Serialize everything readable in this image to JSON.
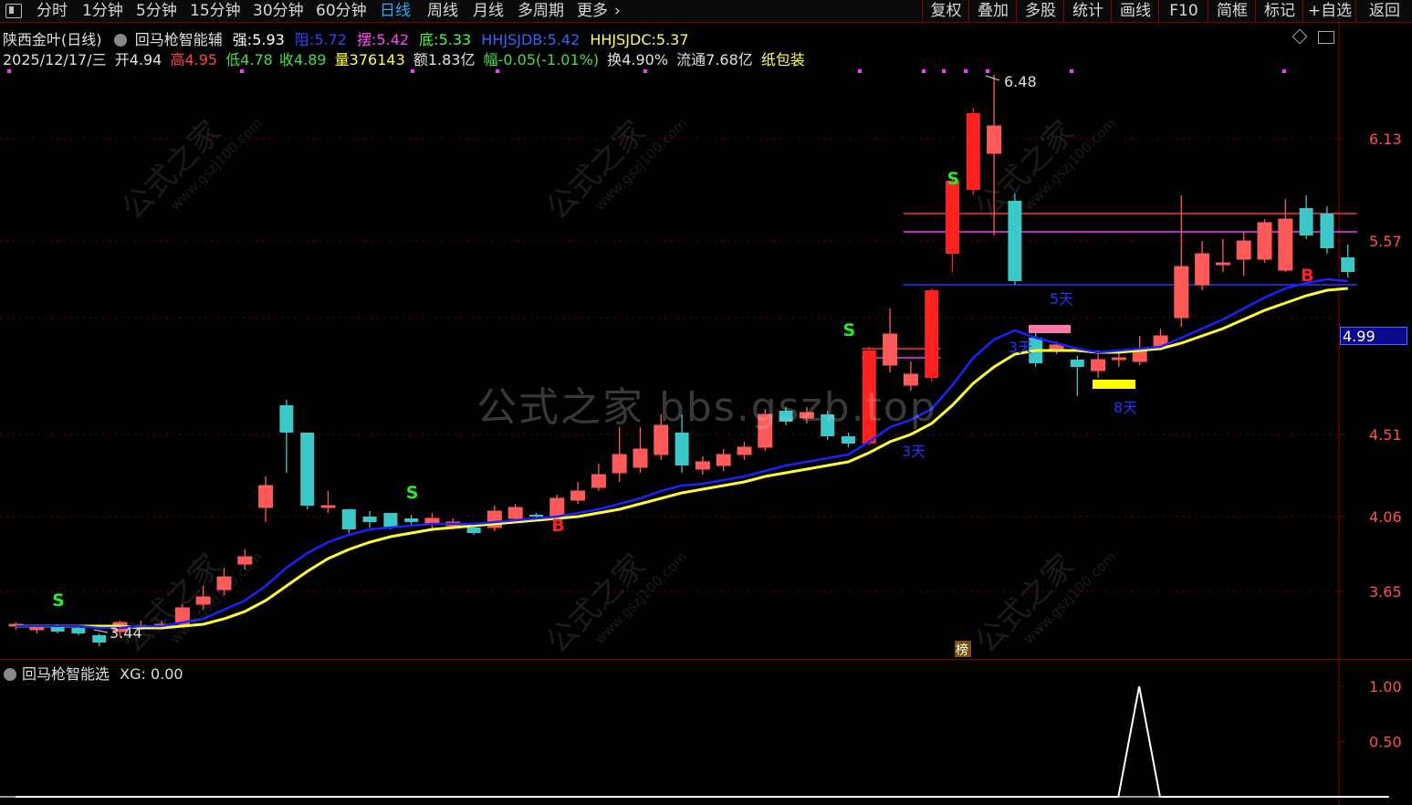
{
  "toolbar": {
    "periods": [
      "分时",
      "1分钟",
      "5分钟",
      "15分钟",
      "30分钟",
      "60分钟",
      "日线",
      "周线",
      "月线",
      "多周期",
      "更多"
    ],
    "active_period": "日线",
    "more_chevron": "›",
    "right_buttons": [
      "复权",
      "叠加",
      "多股",
      "统计",
      "画线",
      "F10",
      "简框",
      "标记",
      "+自选",
      "返回"
    ]
  },
  "header": {
    "stock_name": "陕西金叶(日线)",
    "indicator_name": "回马枪智能辅",
    "strong_label": "强:",
    "strong_value": "5.93",
    "resist_label": "阻:",
    "resist_value": "5.72",
    "swing_label": "摆:",
    "swing_value": "5.42",
    "bottom_label": "底:",
    "bottom_value": "5.33",
    "hhjsjdb_label": "HHJSJDB:",
    "hhjsjdb_value": "5.42",
    "hhjsjdc_label": "HHJSJDC:",
    "hhjsjdc_value": "5.37"
  },
  "quote": {
    "date": "2025/12/17/三",
    "open_label": "开",
    "open": "4.94",
    "high_label": "高",
    "high": "4.95",
    "low_label": "低",
    "low": "4.78",
    "close_label": "收",
    "close": "4.89",
    "volume_label": "量",
    "volume": "376143",
    "amount_label": "额",
    "amount": "1.83亿",
    "change_label": "幅",
    "change": "-0.05(-1.01%)",
    "turnover_label": "换",
    "turnover": "4.90%",
    "float_label": "流通",
    "float": "7.68亿",
    "sector": "纸包装"
  },
  "price_axis": [
    "6.13",
    "5.57",
    "4.51",
    "4.06",
    "3.65"
  ],
  "current_price_tag": "4.99",
  "annotations": {
    "high_marker": "6.48",
    "low_marker": "3.44",
    "signal_S": "S",
    "signal_B": "B",
    "days_5": "5天",
    "days_3": "3天",
    "days_8": "8天",
    "days_3b": "3天",
    "badge": "榜"
  },
  "indicator": {
    "name": "回马枪智能选",
    "xg_label": "XG:",
    "xg_value": "0.00",
    "axis": [
      "1.00",
      "0.50"
    ]
  },
  "watermarks": {
    "center": "公式之家 bbs.gszb.top",
    "diag_cn": "公式之家",
    "diag_url": "www.gszj100.com"
  },
  "colors": {
    "up": "#ff5a5a",
    "up_solid": "#ff2020",
    "down": "#3cc8c8",
    "ma_fast": "#1a22ff",
    "ma_slow": "#ffff33",
    "grid": "#7a0000",
    "axis_text": "#ff5050"
  },
  "chart_data": {
    "type": "candlestick",
    "ylim": [
      3.4,
      6.5
    ],
    "candles": [
      {
        "o": 3.46,
        "c": 3.47,
        "h": 3.48,
        "l": 3.44
      },
      {
        "o": 3.44,
        "c": 3.46,
        "h": 3.47,
        "l": 3.42
      },
      {
        "o": 3.46,
        "c": 3.43,
        "h": 3.47,
        "l": 3.42
      },
      {
        "o": 3.45,
        "c": 3.42,
        "h": 3.46,
        "l": 3.41
      },
      {
        "o": 3.41,
        "c": 3.37,
        "h": 3.42,
        "l": 3.35
      },
      {
        "o": 3.43,
        "c": 3.48,
        "h": 3.49,
        "l": 3.4
      },
      {
        "o": 3.46,
        "c": 3.46,
        "h": 3.49,
        "l": 3.44
      },
      {
        "o": 3.45,
        "c": 3.47,
        "h": 3.49,
        "l": 3.44
      },
      {
        "o": 3.47,
        "c": 3.56,
        "h": 3.58,
        "l": 3.46
      },
      {
        "o": 3.58,
        "c": 3.62,
        "h": 3.68,
        "l": 3.55
      },
      {
        "o": 3.66,
        "c": 3.73,
        "h": 3.78,
        "l": 3.63
      },
      {
        "o": 3.8,
        "c": 3.84,
        "h": 3.88,
        "l": 3.77
      },
      {
        "o": 4.11,
        "c": 4.23,
        "h": 4.28,
        "l": 4.03
      },
      {
        "o": 4.67,
        "c": 4.52,
        "h": 4.7,
        "l": 4.3
      },
      {
        "o": 4.52,
        "c": 4.12,
        "h": 4.52,
        "l": 4.1
      },
      {
        "o": 4.12,
        "c": 4.12,
        "h": 4.2,
        "l": 4.08
      },
      {
        "o": 4.1,
        "c": 3.99,
        "h": 4.1,
        "l": 3.97
      },
      {
        "o": 4.06,
        "c": 4.03,
        "h": 4.09,
        "l": 4.0
      },
      {
        "o": 4.08,
        "c": 4.0,
        "h": 4.08,
        "l": 3.99
      },
      {
        "o": 4.05,
        "c": 4.03,
        "h": 4.07,
        "l": 4.01
      },
      {
        "o": 4.02,
        "c": 4.05,
        "h": 4.08,
        "l": 3.98
      },
      {
        "o": 4.01,
        "c": 4.03,
        "h": 4.05,
        "l": 3.99
      },
      {
        "o": 4.0,
        "c": 3.97,
        "h": 4.02,
        "l": 3.96
      },
      {
        "o": 4.0,
        "c": 4.09,
        "h": 4.12,
        "l": 3.98
      },
      {
        "o": 4.05,
        "c": 4.11,
        "h": 4.13,
        "l": 4.03
      },
      {
        "o": 4.07,
        "c": 4.06,
        "h": 4.08,
        "l": 4.05
      },
      {
        "o": 4.05,
        "c": 4.16,
        "h": 4.18,
        "l": 4.04
      },
      {
        "o": 4.15,
        "c": 4.2,
        "h": 4.25,
        "l": 4.13
      },
      {
        "o": 4.22,
        "c": 4.29,
        "h": 4.35,
        "l": 4.2
      },
      {
        "o": 4.3,
        "c": 4.4,
        "h": 4.55,
        "l": 4.25
      },
      {
        "o": 4.33,
        "c": 4.43,
        "h": 4.55,
        "l": 4.3
      },
      {
        "o": 4.4,
        "c": 4.56,
        "h": 4.62,
        "l": 4.37
      },
      {
        "o": 4.52,
        "c": 4.34,
        "h": 4.62,
        "l": 4.3
      },
      {
        "o": 4.32,
        "c": 4.36,
        "h": 4.39,
        "l": 4.29
      },
      {
        "o": 4.34,
        "c": 4.4,
        "h": 4.43,
        "l": 4.31
      },
      {
        "o": 4.4,
        "c": 4.44,
        "h": 4.47,
        "l": 4.37
      },
      {
        "o": 4.44,
        "c": 4.62,
        "h": 4.65,
        "l": 4.42
      },
      {
        "o": 4.64,
        "c": 4.58,
        "h": 4.66,
        "l": 4.56
      },
      {
        "o": 4.6,
        "c": 4.63,
        "h": 4.66,
        "l": 4.57
      },
      {
        "o": 4.62,
        "c": 4.5,
        "h": 4.64,
        "l": 4.48
      },
      {
        "o": 4.5,
        "c": 4.46,
        "h": 4.52,
        "l": 4.44
      },
      {
        "o": 4.46,
        "c": 4.97,
        "h": 4.99,
        "l": 4.45
      },
      {
        "o": 4.89,
        "c": 5.06,
        "h": 5.2,
        "l": 4.85
      },
      {
        "o": 4.78,
        "c": 4.84,
        "h": 4.91,
        "l": 4.75
      },
      {
        "o": 4.82,
        "c": 5.3,
        "h": 5.31,
        "l": 4.8
      },
      {
        "o": 5.5,
        "c": 5.9,
        "h": 5.92,
        "l": 5.4
      },
      {
        "o": 5.85,
        "c": 6.27,
        "h": 6.3,
        "l": 5.82
      },
      {
        "o": 6.05,
        "c": 6.2,
        "h": 6.48,
        "l": 5.6
      },
      {
        "o": 5.79,
        "c": 5.35,
        "h": 5.83,
        "l": 5.33
      },
      {
        "o": 5.04,
        "c": 4.9,
        "h": 5.08,
        "l": 4.88
      },
      {
        "o": 4.97,
        "c": 5.0,
        "h": 5.02,
        "l": 4.95
      },
      {
        "o": 4.92,
        "c": 4.88,
        "h": 4.94,
        "l": 4.72
      },
      {
        "o": 4.86,
        "c": 4.92,
        "h": 4.97,
        "l": 4.82
      },
      {
        "o": 4.92,
        "c": 4.93,
        "h": 4.97,
        "l": 4.88
      },
      {
        "o": 4.91,
        "c": 4.98,
        "h": 5.05,
        "l": 4.89
      },
      {
        "o": 4.99,
        "c": 5.05,
        "h": 5.09,
        "l": 4.97
      },
      {
        "o": 5.15,
        "c": 5.43,
        "h": 5.82,
        "l": 5.1
      },
      {
        "o": 5.33,
        "c": 5.5,
        "h": 5.57,
        "l": 5.3
      },
      {
        "o": 5.44,
        "c": 5.45,
        "h": 5.58,
        "l": 5.4
      },
      {
        "o": 5.47,
        "c": 5.57,
        "h": 5.62,
        "l": 5.38
      },
      {
        "o": 5.47,
        "c": 5.67,
        "h": 5.69,
        "l": 5.45
      },
      {
        "o": 5.41,
        "c": 5.69,
        "h": 5.8,
        "l": 5.4
      },
      {
        "o": 5.75,
        "c": 5.6,
        "h": 5.82,
        "l": 5.58
      },
      {
        "o": 5.72,
        "c": 5.53,
        "h": 5.76,
        "l": 5.5
      },
      {
        "o": 5.48,
        "c": 5.4,
        "h": 5.55,
        "l": 5.37
      }
    ],
    "ma_fast": [
      3.46,
      3.46,
      3.46,
      3.46,
      3.45,
      3.45,
      3.46,
      3.46,
      3.48,
      3.5,
      3.55,
      3.6,
      3.68,
      3.78,
      3.86,
      3.92,
      3.96,
      3.99,
      4.0,
      4.01,
      4.02,
      4.02,
      4.02,
      4.03,
      4.04,
      4.05,
      4.06,
      4.08,
      4.1,
      4.13,
      4.16,
      4.2,
      4.23,
      4.24,
      4.26,
      4.28,
      4.31,
      4.34,
      4.36,
      4.38,
      4.4,
      4.47,
      4.55,
      4.59,
      4.65,
      4.78,
      4.93,
      5.03,
      5.08,
      5.04,
      5.01,
      4.98,
      4.96,
      4.97,
      4.98,
      4.99,
      5.04,
      5.09,
      5.14,
      5.2,
      5.26,
      5.31,
      5.34,
      5.36,
      5.35
    ],
    "ma_slow": [
      3.46,
      3.46,
      3.46,
      3.46,
      3.46,
      3.46,
      3.45,
      3.45,
      3.46,
      3.47,
      3.5,
      3.54,
      3.6,
      3.68,
      3.76,
      3.83,
      3.88,
      3.92,
      3.95,
      3.97,
      3.99,
      4.0,
      4.01,
      4.02,
      4.03,
      4.04,
      4.05,
      4.06,
      4.08,
      4.1,
      4.13,
      4.16,
      4.19,
      4.21,
      4.23,
      4.25,
      4.28,
      4.3,
      4.32,
      4.34,
      4.36,
      4.41,
      4.47,
      4.51,
      4.57,
      4.67,
      4.79,
      4.88,
      4.95,
      4.97,
      4.97,
      4.97,
      4.96,
      4.96,
      4.97,
      4.98,
      5.01,
      5.05,
      5.09,
      5.14,
      5.19,
      5.23,
      5.27,
      5.3,
      5.31
    ],
    "signals": [
      {
        "type": "S",
        "index": 2,
        "price": 3.57
      },
      {
        "type": "S",
        "index": 19,
        "price": 4.16
      },
      {
        "type": "B",
        "index": 26,
        "price": 3.98
      },
      {
        "type": "S",
        "index": 40,
        "price": 5.05
      },
      {
        "type": "S",
        "index": 45,
        "price": 5.88
      },
      {
        "type": "B",
        "index": 62,
        "price": 5.35
      }
    ],
    "hlines": [
      {
        "price": 5.72,
        "from": 43,
        "to": 64,
        "color": "#ff3030"
      },
      {
        "price": 5.62,
        "from": 43,
        "to": 64,
        "color": "#ff33ff"
      },
      {
        "price": 5.33,
        "from": 43,
        "to": 64,
        "color": "#3030ff"
      },
      {
        "price": 4.98,
        "from": 41,
        "to": 44,
        "color": "#ff3030"
      },
      {
        "price": 4.93,
        "from": 41,
        "to": 44,
        "color": "#ff33ff"
      }
    ],
    "indicator_xg": [
      0,
      0,
      0,
      0,
      0,
      0,
      0,
      0,
      0,
      0,
      0,
      0,
      0,
      0,
      0,
      0,
      0,
      0,
      0,
      0,
      0,
      0,
      0,
      0,
      0,
      0,
      0,
      0,
      0,
      0,
      0,
      0,
      0,
      0,
      0,
      0,
      0,
      0,
      0,
      0,
      0,
      0,
      0,
      0,
      0,
      0,
      0,
      0,
      0,
      0,
      0,
      0,
      1,
      0,
      0,
      0,
      0,
      0,
      0,
      0,
      0,
      0,
      0,
      0,
      0
    ]
  }
}
